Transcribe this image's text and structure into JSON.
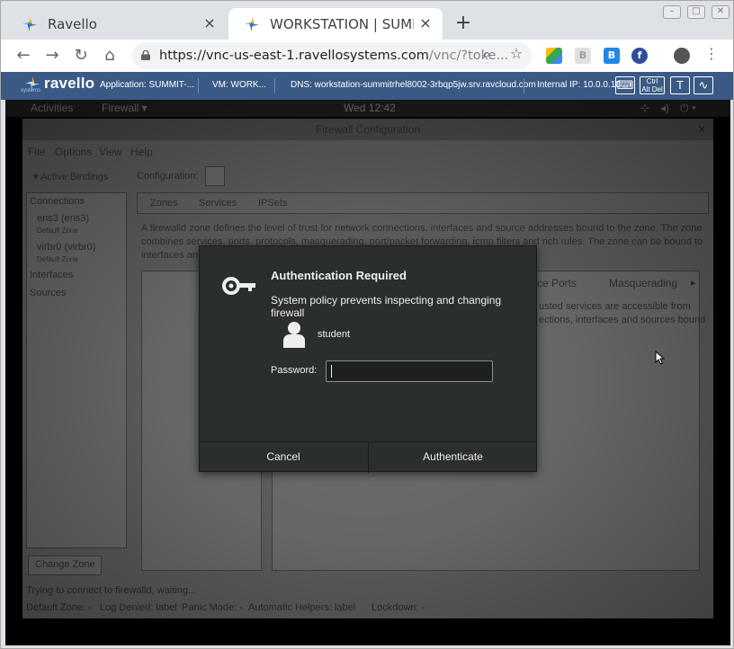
{
  "browser": {
    "tabs": [
      {
        "title": "Ravello",
        "active": false
      },
      {
        "title": "WORKSTATION | SUMMI",
        "active": true
      }
    ],
    "new_tab": "+",
    "close": "×",
    "url_host": "https://vnc-us-east-1.ravellosystems.com",
    "url_rest": "/vnc/?toke..."
  },
  "ravello": {
    "logo": "ravello",
    "logo_sub": "systems",
    "application": "Application: SUMMIT-...",
    "vm": "VM: WORK...",
    "dns": "DNS: workstation-summitrhel8002-3rbqp5jw.srv.ravcloud.com",
    "internal_ip": "Internal IP: 10.0.0.10",
    "ctrl_alt_del_top": "Ctrl",
    "ctrl_alt_del_bottom": "Alt Del",
    "text_btn": "T"
  },
  "gnome": {
    "activities": "Activities",
    "app_menu": "Firewall ▾",
    "clock": "Wed 12:42"
  },
  "firewall": {
    "window_title": "Firewall Configuration",
    "menu": [
      "File",
      "Options",
      "View",
      "Help"
    ],
    "active_bindings": "Active Bindings",
    "configuration_label": "Configuration:",
    "connections": "Connections",
    "conn1": "ens3 (ens3)",
    "conn1_zone": "Default Zone",
    "conn2": "virbr0 (virbr0)",
    "conn2_zone": "Default Zone",
    "interfaces": "Interfaces",
    "sources": "Sources",
    "tabs": [
      "Zones",
      "Services",
      "IPSets"
    ],
    "zone_desc_1": "A firewalld zone defines the level of trust for network connections, interfaces and source addresses bound to the zone. The zone",
    "zone_desc_2": "combines services, ports, protocols, masquerading, port/packet forwarding, icmp filters and rich rules. The zone can be bound to",
    "zone_desc_3": "interfaces an",
    "subtabs_partial": "ce Ports",
    "subtab_masq": "Masquerading",
    "services_desc_1": "usted services are accessible from",
    "services_desc_2": "ections, interfaces and sources bound",
    "change_zone": "Change Zone",
    "status_line": "Trying to connect to firewalld, waiting...",
    "default_zone": "Default Zone: -",
    "log_denied": "Log Denied: label",
    "panic_mode": "Panic Mode: -",
    "auto_helpers": "Automatic Helpers: label",
    "lockdown": "Lockdown: -"
  },
  "auth_dialog": {
    "title": "Authentication Required",
    "message": "System policy prevents inspecting and changing firewall",
    "user": "student",
    "password_label": "Password:",
    "password_value": "",
    "cancel": "Cancel",
    "authenticate": "Authenticate"
  }
}
